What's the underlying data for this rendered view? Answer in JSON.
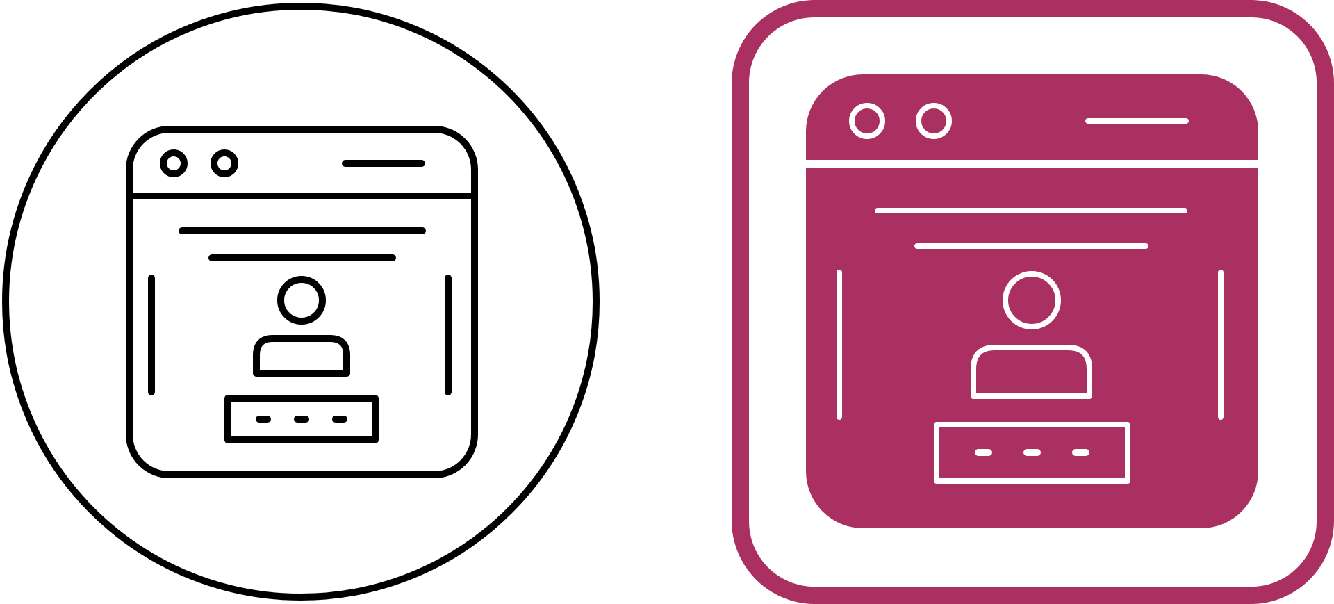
{
  "icons": [
    {
      "name": "login-webpage-icon-outline",
      "style": "outline",
      "frame": "circle",
      "stroke_color": "#000000",
      "background_color": "#ffffff"
    },
    {
      "name": "login-webpage-icon-glyph",
      "style": "filled",
      "frame": "rounded-square",
      "accent_color": "#a93061",
      "stroke_color": "#ffffff",
      "background_color": "#ffffff"
    }
  ]
}
